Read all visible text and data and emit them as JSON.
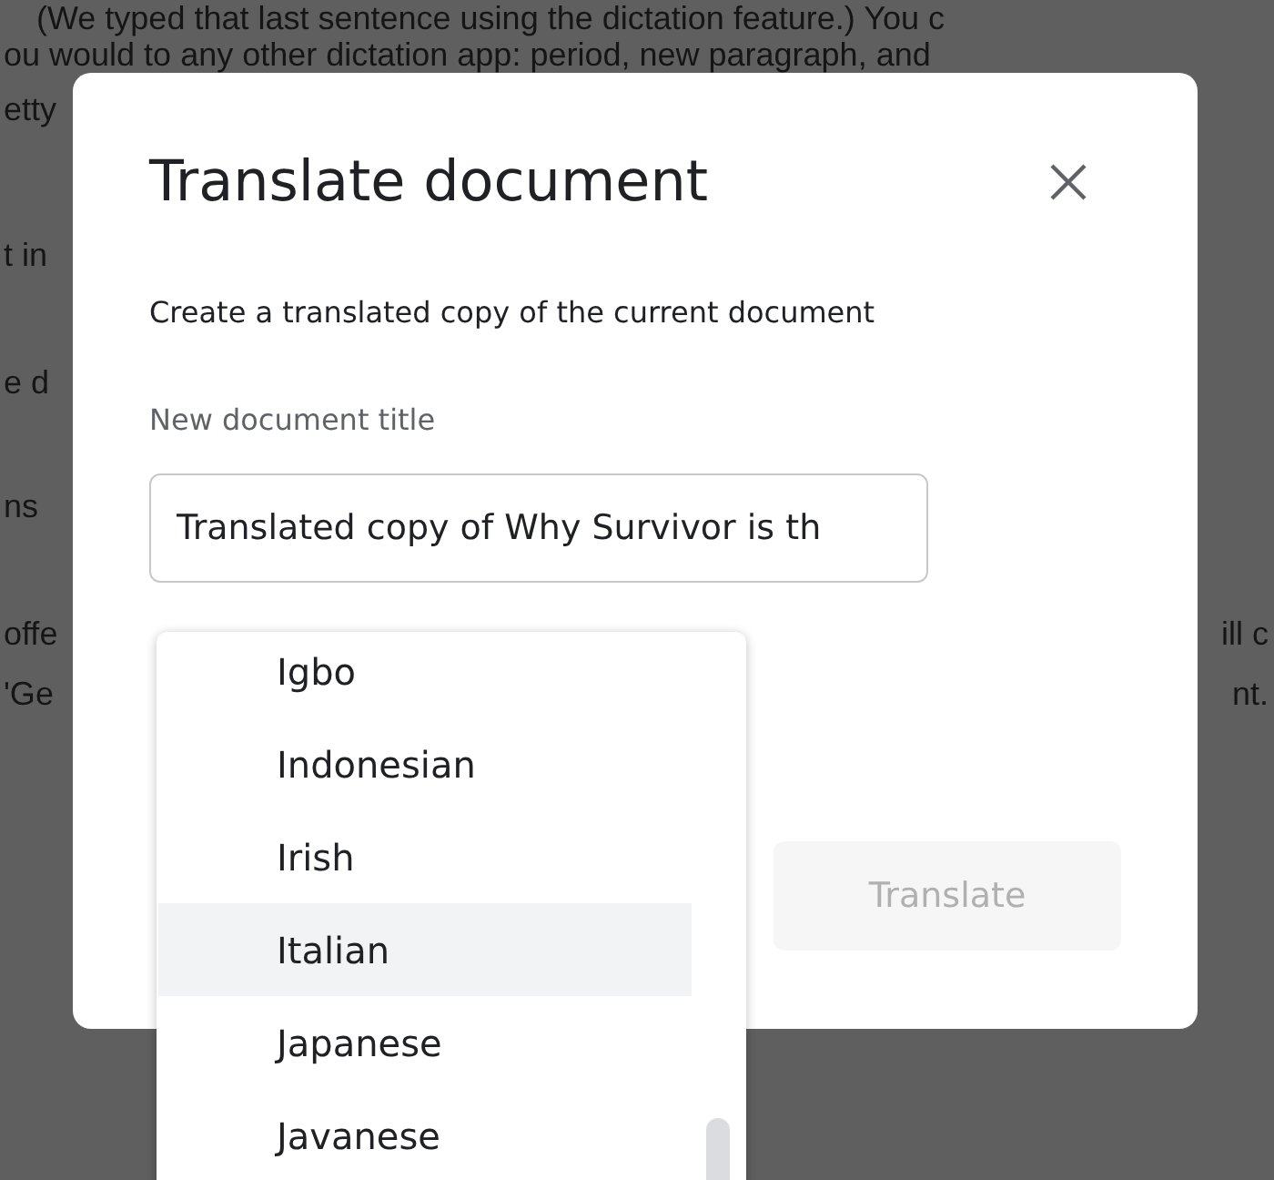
{
  "document": {
    "lines": [
      "(We typed that last sentence using the dictation feature.) You c",
      "ou would to any other dictation app: period, new paragraph, and",
      "etty"
    ],
    "left_fragments": [
      "t in",
      "e d",
      "ns",
      "offe",
      "'Ge"
    ],
    "right_fragments": [
      "ill c",
      "nt."
    ]
  },
  "dialog": {
    "title": "Translate document",
    "subtitle": "Create a translated copy of the current document",
    "field_label": "New document title",
    "title_value": "Translated copy of Why Survivor is th",
    "button": {
      "label": "Translate",
      "disabled": true
    }
  },
  "language_menu": {
    "items": [
      {
        "label": "Igbo",
        "selected": false
      },
      {
        "label": "Indonesian",
        "selected": false
      },
      {
        "label": "Irish",
        "selected": false
      },
      {
        "label": "Italian",
        "selected": true
      },
      {
        "label": "Japanese",
        "selected": false
      },
      {
        "label": "Javanese",
        "selected": false
      }
    ]
  }
}
